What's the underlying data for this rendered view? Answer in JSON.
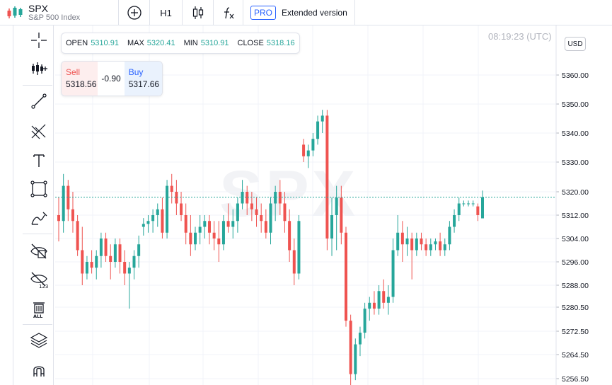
{
  "header": {
    "symbol": "SPX",
    "symbol_name": "S&P 500 Index",
    "timeframe": "H1",
    "pro_badge": "PRO",
    "extended_label": "Extended version"
  },
  "colors": {
    "up": "#26a69a",
    "down": "#ef5350",
    "grid": "#f0f3fa",
    "accent": "#2962ff"
  },
  "left_tools": [
    "crosshair-icon",
    "indicators-icon",
    "trend-line-icon",
    "pitchfork-icon",
    "text-icon",
    "rectangle-icon",
    "brush-icon",
    "hide-drawings-icon",
    "hide-markers-icon",
    "delete-all-icon",
    "layers-icon",
    "magnet-icon"
  ],
  "ohlc": {
    "open_label": "OPEN",
    "open": "5310.91",
    "max_label": "MAX",
    "max": "5320.41",
    "min_label": "MIN",
    "min": "5310.91",
    "close_label": "CLOSE",
    "close": "5318.16"
  },
  "trade": {
    "sell_label": "Sell",
    "sell_price": "5318.56",
    "spread": "-0.90",
    "buy_label": "Buy",
    "buy_price": "5317.66"
  },
  "clock": "08:19:23 (UTC)",
  "currency_button": "USD",
  "watermark": "SPX",
  "chart_data": {
    "type": "candlestick",
    "price_axis_labels": [
      "5360.00",
      "5350.00",
      "5340.00",
      "5330.00",
      "5320.00",
      "5312.00",
      "5304.00",
      "5296.00",
      "5288.00",
      "5280.50",
      "5272.50",
      "5264.50",
      "5256.50"
    ],
    "price_axis_values": [
      5360,
      5350,
      5340,
      5330,
      5320,
      5312,
      5304,
      5296,
      5288,
      5280.5,
      5272.5,
      5264.5,
      5256.5
    ],
    "current_price": 5318.16,
    "candles": [
      [
        5312,
        5318,
        5303,
        5310
      ],
      [
        5310,
        5326,
        5306,
        5322
      ],
      [
        5322,
        5324,
        5310,
        5314
      ],
      [
        5314,
        5320,
        5306,
        5310
      ],
      [
        5310,
        5312,
        5298,
        5300
      ],
      [
        5300,
        5308,
        5288,
        5292
      ],
      [
        5292,
        5298,
        5290,
        5296
      ],
      [
        5296,
        5300,
        5292,
        5294
      ],
      [
        5294,
        5300,
        5290,
        5298
      ],
      [
        5298,
        5306,
        5294,
        5304
      ],
      [
        5304,
        5306,
        5296,
        5298
      ],
      [
        5298,
        5302,
        5290,
        5296
      ],
      [
        5296,
        5304,
        5294,
        5302
      ],
      [
        5302,
        5304,
        5292,
        5296
      ],
      [
        5296,
        5300,
        5288,
        5292
      ],
      [
        5292,
        5296,
        5280,
        5294
      ],
      [
        5294,
        5300,
        5290,
        5298
      ],
      [
        5298,
        5305,
        5294,
        5302
      ],
      [
        5308,
        5311,
        5305,
        5309
      ],
      [
        5309,
        5312,
        5306,
        5310
      ],
      [
        5310,
        5314,
        5306,
        5312
      ],
      [
        5312,
        5316,
        5308,
        5314
      ],
      [
        5314,
        5318,
        5304,
        5306
      ],
      [
        5306,
        5324,
        5304,
        5322
      ],
      [
        5322,
        5326,
        5316,
        5320
      ],
      [
        5320,
        5324,
        5312,
        5316
      ],
      [
        5316,
        5320,
        5310,
        5312
      ],
      [
        5312,
        5316,
        5302,
        5306
      ],
      [
        5306,
        5312,
        5298,
        5302
      ],
      [
        5302,
        5308,
        5300,
        5306
      ],
      [
        5306,
        5312,
        5302,
        5308
      ],
      [
        5308,
        5312,
        5304,
        5310
      ],
      [
        5310,
        5312,
        5302,
        5306
      ],
      [
        5306,
        5310,
        5300,
        5304
      ],
      [
        5304,
        5310,
        5296,
        5302
      ],
      [
        5302,
        5312,
        5300,
        5310
      ],
      [
        5310,
        5316,
        5306,
        5308
      ],
      [
        5308,
        5314,
        5304,
        5310
      ],
      [
        5310,
        5318,
        5306,
        5316
      ],
      [
        5316,
        5324,
        5314,
        5320
      ],
      [
        5320,
        5322,
        5312,
        5316
      ],
      [
        5316,
        5320,
        5310,
        5314
      ],
      [
        5314,
        5318,
        5308,
        5312
      ],
      [
        5312,
        5316,
        5306,
        5310
      ],
      [
        5310,
        5314,
        5304,
        5306
      ],
      [
        5306,
        5318,
        5302,
        5316
      ],
      [
        5316,
        5322,
        5310,
        5320
      ],
      [
        5320,
        5324,
        5312,
        5316
      ],
      [
        5316,
        5320,
        5306,
        5310
      ],
      [
        5310,
        5314,
        5296,
        5300
      ],
      [
        5300,
        5304,
        5288,
        5292
      ],
      [
        5292,
        5312,
        5290,
        5310
      ],
      [
        5336,
        5338,
        5330,
        5332
      ],
      [
        5332,
        5336,
        5328,
        5334
      ],
      [
        5334,
        5340,
        5332,
        5338
      ],
      [
        5338,
        5346,
        5336,
        5344
      ],
      [
        5344,
        5348,
        5340,
        5346
      ],
      [
        5346,
        5348,
        5300,
        5304
      ],
      [
        5304,
        5318,
        5298,
        5312
      ],
      [
        5312,
        5322,
        5300,
        5318
      ],
      [
        5318,
        5322,
        5302,
        5306
      ],
      [
        5306,
        5308,
        5274,
        5276
      ],
      [
        5276,
        5278,
        5254,
        5258
      ],
      [
        5258,
        5270,
        5256,
        5268
      ],
      [
        5268,
        5274,
        5264,
        5272
      ],
      [
        5272,
        5282,
        5270,
        5280
      ],
      [
        5280,
        5284,
        5276,
        5282
      ],
      [
        5282,
        5286,
        5278,
        5280
      ],
      [
        5280,
        5288,
        5278,
        5286
      ],
      [
        5286,
        5290,
        5280,
        5282
      ],
      [
        5282,
        5288,
        5278,
        5284
      ],
      [
        5284,
        5304,
        5282,
        5300
      ],
      [
        5300,
        5312,
        5298,
        5306
      ],
      [
        5306,
        5310,
        5296,
        5302
      ],
      [
        5302,
        5308,
        5298,
        5304
      ],
      [
        5304,
        5306,
        5290,
        5300
      ],
      [
        5300,
        5306,
        5298,
        5304
      ],
      [
        5304,
        5306,
        5300,
        5302
      ],
      [
        5302,
        5304,
        5298,
        5300
      ],
      [
        5300,
        5304,
        5298,
        5302
      ],
      [
        5302,
        5304,
        5300,
        5303
      ],
      [
        5303,
        5306,
        5298,
        5300
      ],
      [
        5300,
        5304,
        5298,
        5302
      ],
      [
        5302,
        5310,
        5300,
        5308
      ],
      [
        5308,
        5314,
        5306,
        5312
      ],
      [
        5312,
        5318,
        5310,
        5316
      ],
      [
        5316,
        5317,
        5315,
        5316
      ],
      [
        5316,
        5317,
        5315,
        5316
      ],
      [
        5316,
        5317,
        5315,
        5316
      ],
      [
        5315,
        5316,
        5310,
        5312
      ],
      [
        5310.91,
        5320.41,
        5310.91,
        5318.16
      ]
    ]
  }
}
